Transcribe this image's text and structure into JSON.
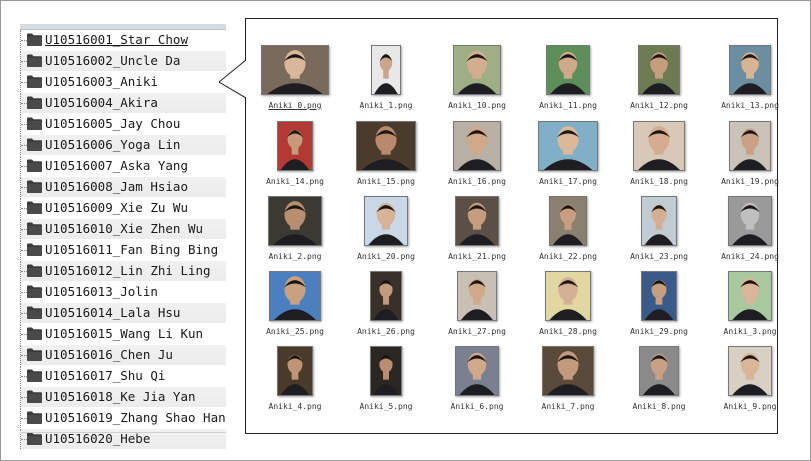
{
  "folders": [
    {
      "label": "U10516001_Star Chow"
    },
    {
      "label": "U10516002_Uncle Da"
    },
    {
      "label": "U10516003_Aniki"
    },
    {
      "label": "U10516004_Akira"
    },
    {
      "label": "U10516005_Jay Chou"
    },
    {
      "label": "U10516006_Yoga Lin"
    },
    {
      "label": "U10516007_Aska Yang"
    },
    {
      "label": "U10516008_Jam Hsiao"
    },
    {
      "label": "U10516009_Xie Zu Wu"
    },
    {
      "label": "U10516010_Xie Zhen Wu"
    },
    {
      "label": "U10516011_Fan Bing Bing"
    },
    {
      "label": "U10516012_Lin Zhi Ling"
    },
    {
      "label": "U10516013_Jolin"
    },
    {
      "label": "U10516014_Lala Hsu"
    },
    {
      "label": "U10516015_Wang Li Kun"
    },
    {
      "label": "U10516016_Chen Ju"
    },
    {
      "label": "U10516017_Shu Qi"
    },
    {
      "label": "U10516018_Ke Jia Yan"
    },
    {
      "label": "U10516019_Zhang Shao Han"
    },
    {
      "label": "U10516020_Hebe"
    }
  ],
  "files": [
    {
      "name": "Aniki_0.png",
      "bg": "#7a6a5c",
      "tone": "#d9b79a"
    },
    {
      "name": "Aniki_1.png",
      "bg": "#e8e8e8",
      "tone": "#c9a58a"
    },
    {
      "name": "Aniki_10.png",
      "bg": "#9fae84",
      "tone": "#d2ad8e"
    },
    {
      "name": "Aniki_11.png",
      "bg": "#5d8f5a",
      "tone": "#cfa98c"
    },
    {
      "name": "Aniki_12.png",
      "bg": "#6e7a52",
      "tone": "#c59e80"
    },
    {
      "name": "Aniki_13.png",
      "bg": "#6b8fa0",
      "tone": "#d8b394"
    },
    {
      "name": "Aniki_14.png",
      "bg": "#b23a32",
      "tone": "#c79a7c"
    },
    {
      "name": "Aniki_15.png",
      "bg": "#4a3b2c",
      "tone": "#b8896a"
    },
    {
      "name": "Aniki_16.png",
      "bg": "#b8b0a4",
      "tone": "#d0a88a"
    },
    {
      "name": "Aniki_17.png",
      "bg": "#7fb0c8",
      "tone": "#dcb89a"
    },
    {
      "name": "Aniki_18.png",
      "bg": "#d8c8b8",
      "tone": "#d4ad90"
    },
    {
      "name": "Aniki_19.png",
      "bg": "#c9c2b8",
      "tone": "#caa184"
    },
    {
      "name": "Aniki_2.png",
      "bg": "#3a3a32",
      "tone": "#b88e70"
    },
    {
      "name": "Aniki_20.png",
      "bg": "#c8d8e6",
      "tone": "#d6b296"
    },
    {
      "name": "Aniki_21.png",
      "bg": "#5a5048",
      "tone": "#c69c7e"
    },
    {
      "name": "Aniki_22.png",
      "bg": "#8a8070",
      "tone": "#c89e80"
    },
    {
      "name": "Aniki_23.png",
      "bg": "#c0ccd2",
      "tone": "#d4ae92"
    },
    {
      "name": "Aniki_24.png",
      "bg": "#9a9a9a",
      "tone": "#bfbfbf"
    },
    {
      "name": "Aniki_25.png",
      "bg": "#4a7fc0",
      "tone": "#c9a080"
    },
    {
      "name": "Aniki_26.png",
      "bg": "#3a302a",
      "tone": "#c49a7c"
    },
    {
      "name": "Aniki_27.png",
      "bg": "#c8c0b4",
      "tone": "#d0a88a"
    },
    {
      "name": "Aniki_28.png",
      "bg": "#e0d8a0",
      "tone": "#d6b094"
    },
    {
      "name": "Aniki_29.png",
      "bg": "#3a5a8a",
      "tone": "#c69e80"
    },
    {
      "name": "Aniki_3.png",
      "bg": "#a8c8a0",
      "tone": "#dab698"
    },
    {
      "name": "Aniki_4.png",
      "bg": "#4a3a2a",
      "tone": "#c09474"
    },
    {
      "name": "Aniki_5.png",
      "bg": "#2a2622",
      "tone": "#b98e70"
    },
    {
      "name": "Aniki_6.png",
      "bg": "#7a8090",
      "tone": "#d0a88a"
    },
    {
      "name": "Aniki_7.png",
      "bg": "#5a4a3a",
      "tone": "#c49a7c"
    },
    {
      "name": "Aniki_8.png",
      "bg": "#8a8a8a",
      "tone": "#c8a084"
    },
    {
      "name": "Aniki_9.png",
      "bg": "#d8d0c4",
      "tone": "#dab698"
    }
  ],
  "colors": {
    "folder": "#3c3c3c",
    "alt_row": "#efefef",
    "border": "#222222"
  }
}
